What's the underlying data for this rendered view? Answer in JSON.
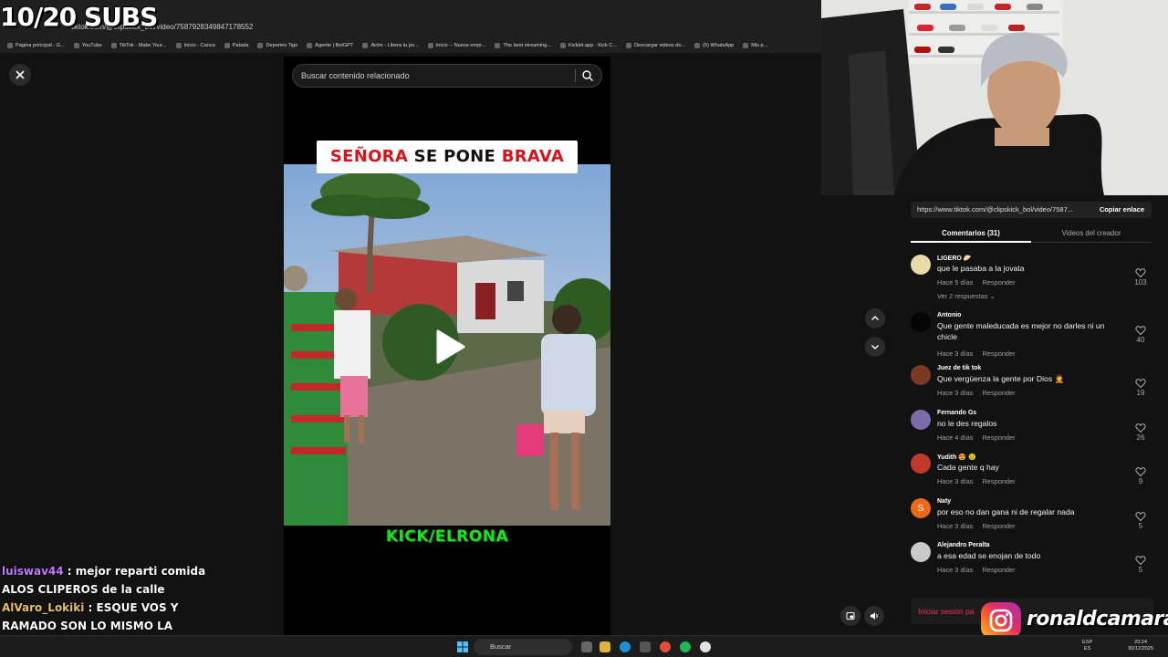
{
  "overlay": {
    "subs_counter": "10/20 SUBS"
  },
  "browser": {
    "url": "tiktok.com/@clipskick_bol/video/7587928349847178552",
    "bookmarks": [
      "Página principal - G...",
      "YouTube",
      "TikTok - Make Your...",
      "Inicio - Canva",
      "Patada",
      "Deportes Tigo",
      "Agente | BetGPT",
      "Airtm - Libera tu po...",
      "Inicio -- Nueva empr...",
      "The best streaming...",
      "Kicklet.app - Kick C...",
      "Descargar videos de...",
      "(5) WhatsApp",
      "Mis p..."
    ]
  },
  "video": {
    "search_placeholder": "Buscar contenido relacionado",
    "caption_red": "SEÑORA",
    "caption_black": " SE PONE ",
    "caption_red2": "BRAVA",
    "watermark": "KICK/ELRONA"
  },
  "panel": {
    "link_url": "https://www.tiktok.com/@clipskick_bol/video/7587...",
    "copy_label": "Copiar enlace",
    "tab_comments": "Comentarios (31)",
    "tab_videos": "Videos del creador",
    "reply_label": "Responder",
    "login_label": "Iniciar sesión pa"
  },
  "comments": [
    {
      "user": "LIGERO 🥟",
      "text": "que le pasaba a la jovata",
      "time": "Hace 5 días",
      "likes": "103",
      "avatar_color": "#e8d9a8",
      "replies": "Ver 2 respuestas ⌄"
    },
    {
      "user": "Antonio",
      "text": "Que gente maleducada es mejor no darles ni un chicle",
      "time": "Hace 3 días",
      "likes": "40",
      "avatar_color": "#050505"
    },
    {
      "user": "Juez de tik tok",
      "text": "Que vergüenza la gente por Dios 🤦",
      "time": "Hace 3 días",
      "likes": "19",
      "avatar_color": "#7a3a22"
    },
    {
      "user": "Fernando Gs",
      "text": "no le des regalos",
      "time": "Hace 4 días",
      "likes": "26",
      "avatar_color": "#7d6aa8"
    },
    {
      "user": "Yudith 😍 😢",
      "text": "Cada gente q hay",
      "time": "Hace 3 días",
      "likes": "9",
      "avatar_color": "#c0392b"
    },
    {
      "user": "Naty",
      "text": "por eso no dan gana ni de regalar nada",
      "time": "Hace 3 días",
      "likes": "5",
      "avatar_color": "#e86a1a",
      "avatar_letter": "S"
    },
    {
      "user": "Alejandro Peralta",
      "text": "a esa edad se enojan de todo",
      "time": "Hace 3 días",
      "likes": "5",
      "avatar_color": "#c9c9c9"
    }
  ],
  "chat": {
    "msg1_user": "luiswav44",
    "msg1_text": " : mejor reparti comida ALOS CLIPEROS de la calle",
    "msg2_user": "AlVaro_Lokiki",
    "msg2_text": " : ESQUE VOS Y RAMADO SON LO MISMO LA HEMBRA SOLO QUERIA MONEY Y PORESO LOS DEJO"
  },
  "instagram": {
    "handle": "ronaldcamaras"
  },
  "taskbar": {
    "search": "Buscar",
    "lang": "ESP",
    "lang2": "ES",
    "time": "20:24",
    "date": "30/12/2025"
  }
}
